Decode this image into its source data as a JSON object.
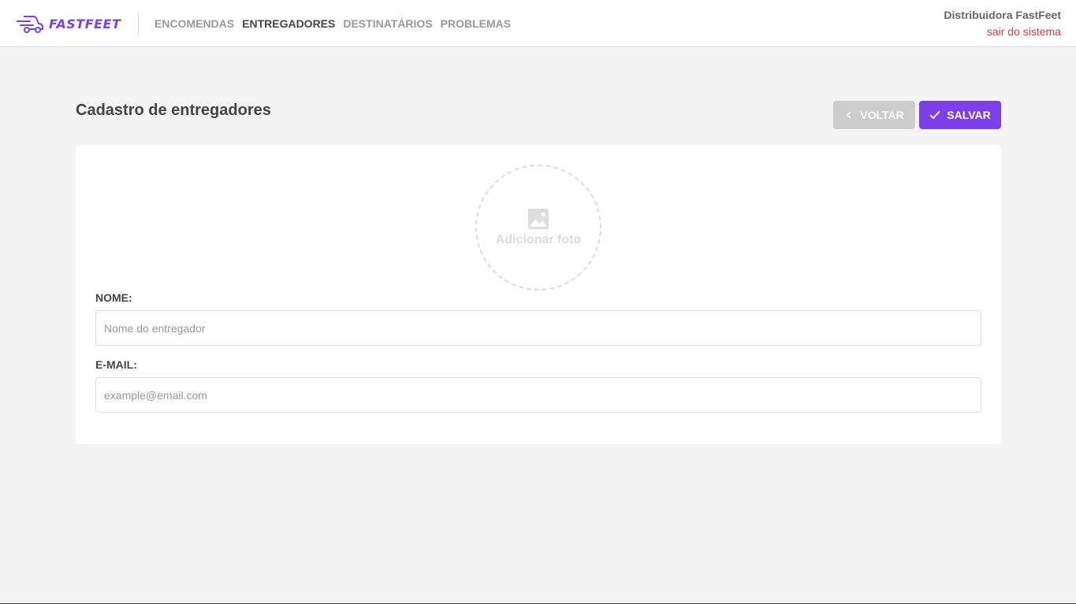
{
  "header": {
    "logo_text": "FASTFEET",
    "nav": [
      {
        "label": "ENCOMENDAS",
        "active": false
      },
      {
        "label": "ENTREGADORES",
        "active": true
      },
      {
        "label": "DESTINATÁRIOS",
        "active": false
      },
      {
        "label": "PROBLEMAS",
        "active": false
      }
    ],
    "profile_name": "Distribuidora FastFeet",
    "logout_label": "sair do sistema"
  },
  "page": {
    "title": "Cadastro de entregadores",
    "back_label": "VOLTAR",
    "save_label": "SALVAR"
  },
  "form": {
    "photo_label": "Adicionar foto",
    "name_label": "NOME:",
    "name_value": "",
    "name_placeholder": "Nome do entregador",
    "email_label": "E-MAIL:",
    "email_value": "",
    "email_placeholder": "example@email.com"
  },
  "colors": {
    "brand": "#7d40e7",
    "logout": "#de3b3b",
    "back_button": "#cccccc",
    "background": "#f4f4f4"
  },
  "icons": [
    "truck-logo-icon",
    "chevron-left-icon",
    "check-icon",
    "image-icon"
  ]
}
